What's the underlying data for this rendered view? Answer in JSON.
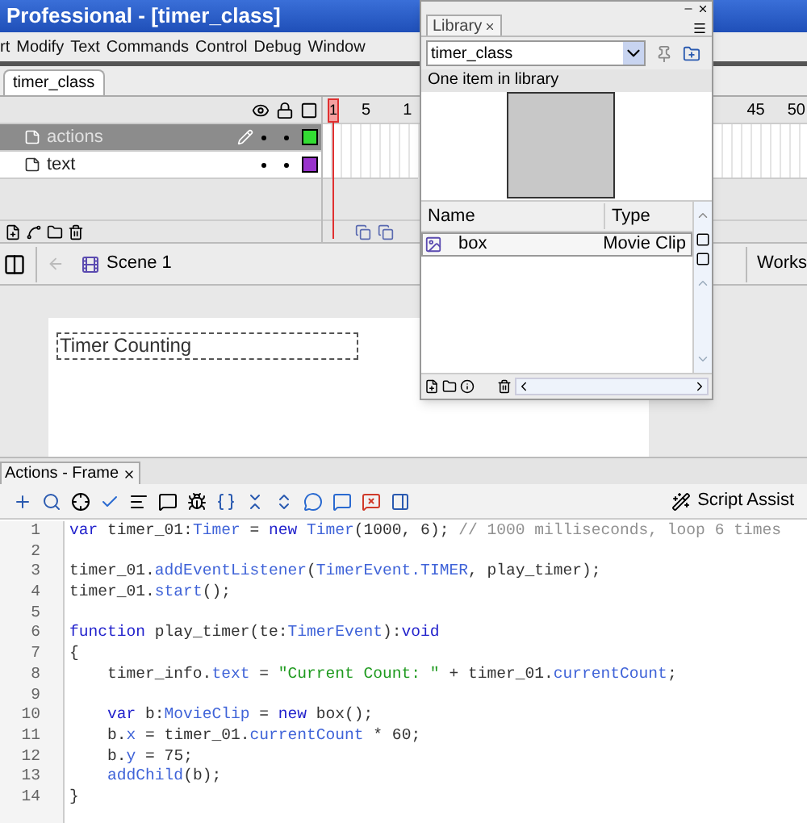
{
  "window": {
    "title": "Professional - [timer_class]"
  },
  "menu": [
    "rt",
    "Modify",
    "Text",
    "Commands",
    "Control",
    "Debug",
    "Window"
  ],
  "document_tab": {
    "label": "timer_class"
  },
  "timeline": {
    "playhead_label": "1",
    "ruler_labels": [
      "5",
      "1",
      "45",
      "50"
    ],
    "layers": [
      {
        "name": "actions",
        "selected": true,
        "color": "#33dd33"
      },
      {
        "name": "text",
        "selected": false,
        "color": "#9933cc"
      }
    ]
  },
  "edit_bar": {
    "scene": "Scene 1",
    "workspace": "Works"
  },
  "stage": {
    "text_field": "Timer Counting"
  },
  "library": {
    "tab": "Library",
    "source": "timer_class",
    "count": "One item in library",
    "columns": [
      "Name",
      "Type"
    ],
    "items": [
      {
        "name": "box",
        "type": "Movie Clip",
        "selected": true
      }
    ]
  },
  "actions": {
    "tab": "Actions - Frame",
    "script_assist": "Script Assist",
    "lines": [
      {
        "number": "1",
        "segments": [
          {
            "text": "var",
            "kind": "keyword"
          },
          {
            "text": " timer_01:",
            "kind": "plain"
          },
          {
            "text": "Timer",
            "kind": "builtin"
          },
          {
            "text": " = ",
            "kind": "plain"
          },
          {
            "text": "new",
            "kind": "keyword"
          },
          {
            "text": " Timer",
            "kind": "builtin"
          },
          {
            "text": "(1000, 6); ",
            "kind": "plain"
          },
          {
            "text": "// 1000 milliseconds, loop 6 times",
            "kind": "comment"
          }
        ]
      },
      {
        "number": "2"
      },
      {
        "number": "3",
        "segments": [
          {
            "text": "timer_01.",
            "kind": "plain"
          },
          {
            "text": "addEventListener",
            "kind": "builtin"
          },
          {
            "text": "(",
            "kind": "plain"
          },
          {
            "text": "TimerEvent.TIMER",
            "kind": "builtin"
          },
          {
            "text": ", play_timer);",
            "kind": "plain"
          }
        ]
      },
      {
        "number": "4",
        "segments": [
          {
            "text": "timer_01.",
            "kind": "plain"
          },
          {
            "text": "start",
            "kind": "builtin"
          },
          {
            "text": "();",
            "kind": "plain"
          }
        ]
      },
      {
        "number": "5"
      },
      {
        "number": "6",
        "segments": [
          {
            "text": "function",
            "kind": "keyword"
          },
          {
            "text": " play_timer(te:",
            "kind": "plain"
          },
          {
            "text": "TimerEvent",
            "kind": "builtin"
          },
          {
            "text": "):",
            "kind": "plain"
          },
          {
            "text": "void",
            "kind": "keyword"
          }
        ]
      },
      {
        "number": "7",
        "segments": [
          {
            "text": "{",
            "kind": "plain"
          }
        ]
      },
      {
        "number": "8",
        "segments": [
          {
            "text": "    timer_info.",
            "kind": "plain"
          },
          {
            "text": "text",
            "kind": "builtin"
          },
          {
            "text": " = ",
            "kind": "plain"
          },
          {
            "text": "\"Current Count: \"",
            "kind": "string"
          },
          {
            "text": " + timer_01.",
            "kind": "plain"
          },
          {
            "text": "currentCount",
            "kind": "builtin"
          },
          {
            "text": ";",
            "kind": "plain"
          }
        ]
      },
      {
        "number": "9"
      },
      {
        "number": "10",
        "segments": [
          {
            "text": "    var",
            "kind": "keyword"
          },
          {
            "text": " b:",
            "kind": "plain"
          },
          {
            "text": "MovieClip",
            "kind": "builtin"
          },
          {
            "text": " = ",
            "kind": "plain"
          },
          {
            "text": "new",
            "kind": "keyword"
          },
          {
            "text": " box();",
            "kind": "plain"
          }
        ]
      },
      {
        "number": "11",
        "segments": [
          {
            "text": "    b.",
            "kind": "plain"
          },
          {
            "text": "x",
            "kind": "builtin"
          },
          {
            "text": " = timer_01.",
            "kind": "plain"
          },
          {
            "text": "currentCount",
            "kind": "builtin"
          },
          {
            "text": " * 60;",
            "kind": "plain"
          }
        ]
      },
      {
        "number": "12",
        "segments": [
          {
            "text": "    b.",
            "kind": "plain"
          },
          {
            "text": "y",
            "kind": "builtin"
          },
          {
            "text": " = 75;",
            "kind": "plain"
          }
        ]
      },
      {
        "number": "13",
        "segments": [
          {
            "text": "    addChild",
            "kind": "builtin"
          },
          {
            "text": "(b);",
            "kind": "plain"
          }
        ]
      },
      {
        "number": "14",
        "segments": [
          {
            "text": "}",
            "kind": "plain"
          }
        ]
      }
    ]
  }
}
